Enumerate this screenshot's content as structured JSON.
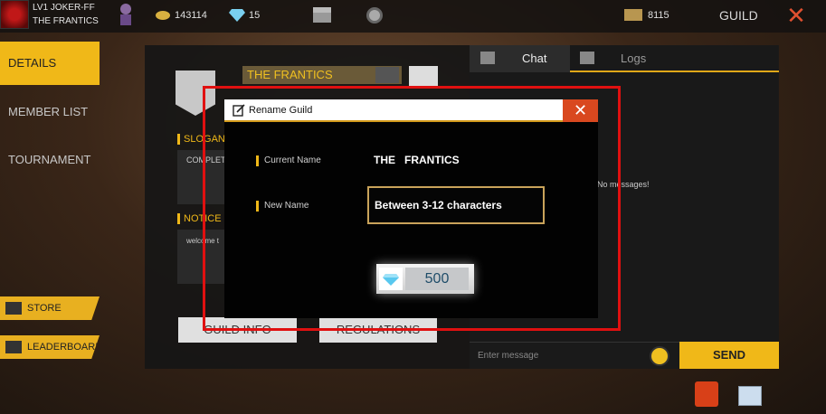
{
  "player": {
    "name": "LV1 JOKER-FF",
    "guild_name": "THE FRANTICS"
  },
  "resources": {
    "gold": "143114",
    "diamonds": "15",
    "guild_currency": "8115"
  },
  "header": {
    "title": "GUILD",
    "close_label": "✕"
  },
  "sidebar": {
    "items": [
      {
        "label": "DETAILS",
        "active": true
      },
      {
        "label": "MEMBER LIST",
        "active": false
      },
      {
        "label": "TOURNAMENT",
        "active": false
      }
    ],
    "store_label": "STORE",
    "leaderboard_label": "LEADERBOARD"
  },
  "guild_panel": {
    "name": "THE FRANTICS",
    "slogan_label": "SLOGAN",
    "slogan_text": "COMPLETE",
    "notice_label": "NOTICE",
    "notice_text": "welcome t",
    "guild_info_label": "GUILD INFO",
    "regulations_label": "REGULATIONS"
  },
  "chat": {
    "tabs": [
      {
        "label": "Chat"
      },
      {
        "label": "Logs"
      }
    ],
    "empty_text": "No messages!",
    "input_placeholder": "Enter message",
    "send_label": "SEND"
  },
  "modal": {
    "title": "Rename Guild",
    "close_label": "✕",
    "current_name_label": "Current Name",
    "current_name_value": "THE   FRANTICS",
    "new_name_label": "New Name",
    "new_name_placeholder": "Between 3-12 characters",
    "cost": "500"
  },
  "colors": {
    "accent": "#f0b818",
    "highlight": "#e01010",
    "modal_close": "#d9481f",
    "price_text": "#1f4d69"
  }
}
